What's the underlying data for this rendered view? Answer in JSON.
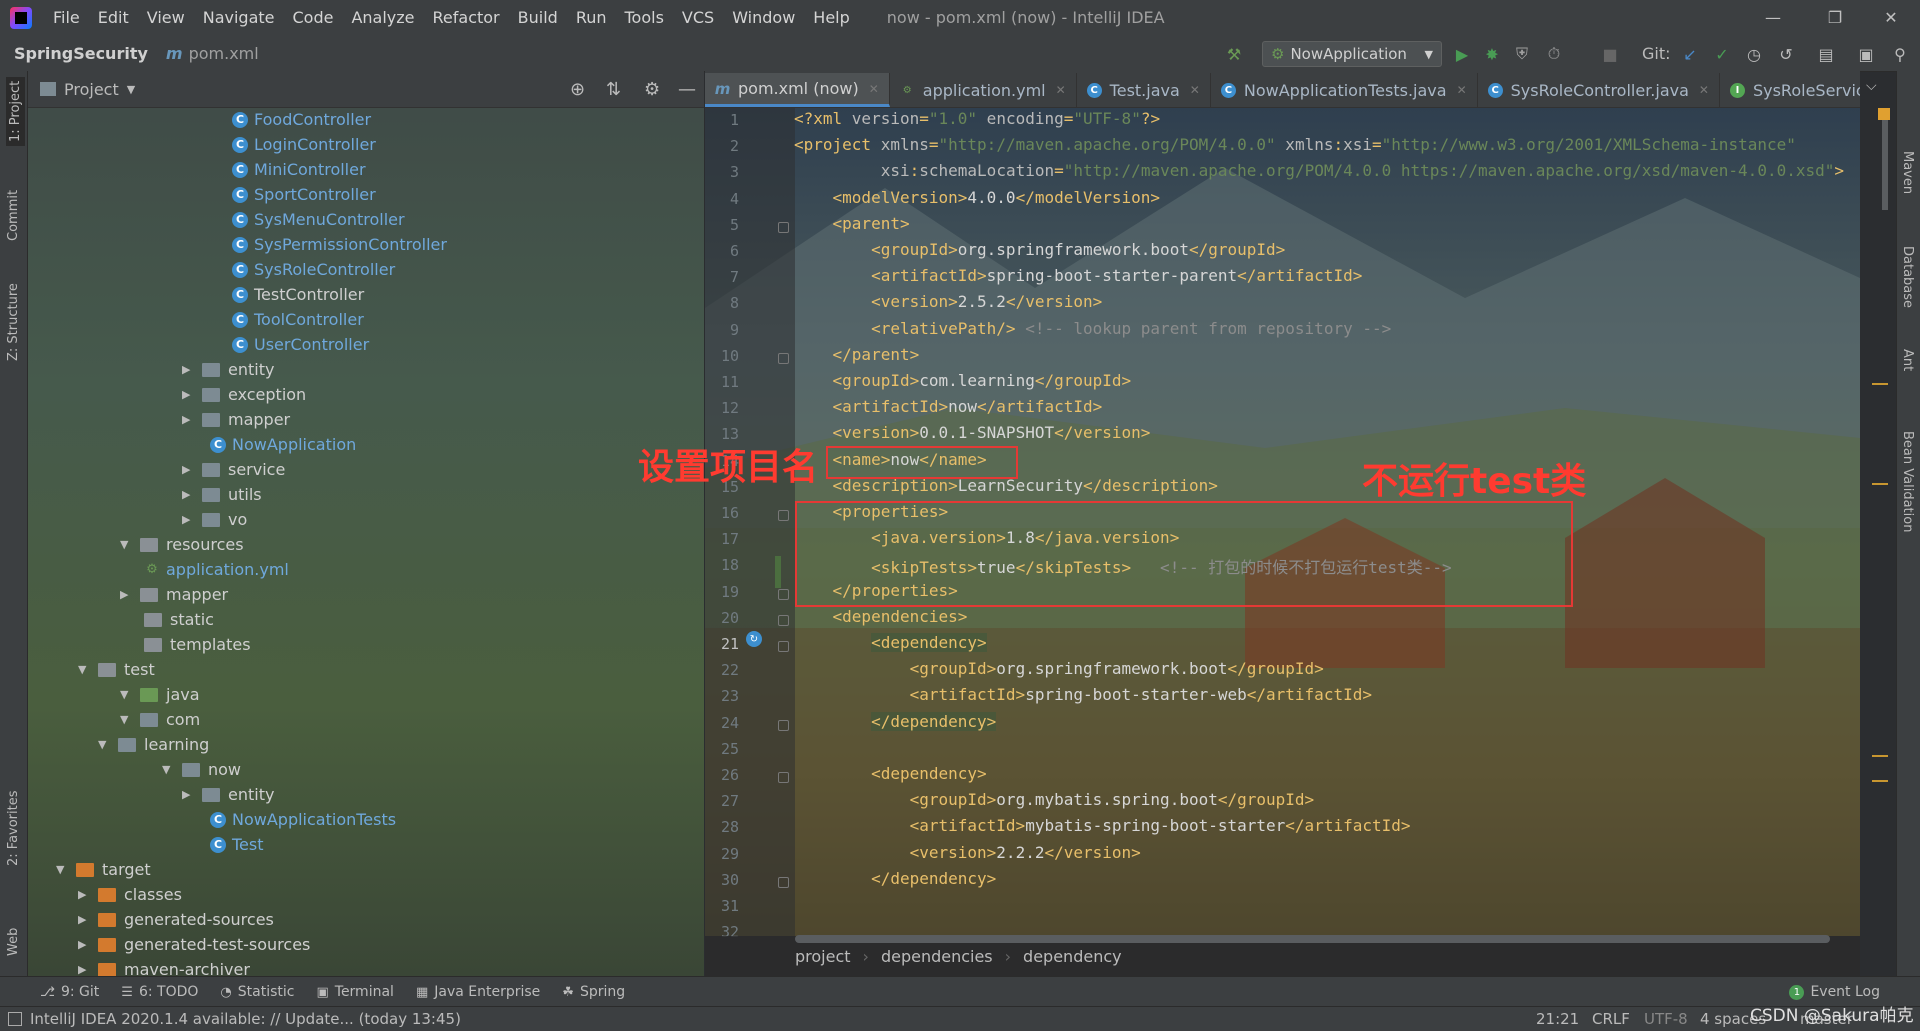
{
  "window": {
    "title": "now - pom.xml (now) - IntelliJ IDEA",
    "menu": [
      "File",
      "Edit",
      "View",
      "Navigate",
      "Code",
      "Analyze",
      "Refactor",
      "Build",
      "Run",
      "Tools",
      "VCS",
      "Window",
      "Help"
    ]
  },
  "navbar": {
    "project": "SpringSecurity",
    "file": "pom.xml",
    "file_icon": "m",
    "run_config": "NowApplication",
    "git_label": "Git:"
  },
  "project_panel": {
    "title": "Project",
    "tree": [
      {
        "label": "FoodController",
        "type": "class",
        "indent": 0
      },
      {
        "label": "LoginController",
        "type": "class",
        "indent": 0
      },
      {
        "label": "MiniController",
        "type": "class",
        "indent": 0
      },
      {
        "label": "SportController",
        "type": "class",
        "indent": 0
      },
      {
        "label": "SysMenuController",
        "type": "class",
        "indent": 0
      },
      {
        "label": "SysPermissionController",
        "type": "class",
        "indent": 0
      },
      {
        "label": "SysRoleController",
        "type": "class",
        "indent": 0
      },
      {
        "label": "TestController",
        "type": "class",
        "indent": 0
      },
      {
        "label": "ToolController",
        "type": "class",
        "indent": 0
      },
      {
        "label": "UserController",
        "type": "class",
        "indent": 0
      },
      {
        "label": "entity",
        "type": "pkg",
        "indent": 1
      },
      {
        "label": "exception",
        "type": "pkg",
        "indent": 1
      },
      {
        "label": "mapper",
        "type": "pkg",
        "indent": 1
      },
      {
        "label": "NowApplication",
        "type": "app",
        "indent": 2
      },
      {
        "label": "service",
        "type": "pkg",
        "indent": 1
      },
      {
        "label": "utils",
        "type": "pkg",
        "indent": 1
      },
      {
        "label": "vo",
        "type": "pkg",
        "indent": 1
      },
      {
        "label": "resources",
        "type": "folder-open",
        "indent": 3
      },
      {
        "label": "application.yml",
        "type": "yml",
        "indent": 4
      },
      {
        "label": "mapper",
        "type": "folder",
        "indent": 5
      },
      {
        "label": "static",
        "type": "folder-leaf",
        "indent": 4
      },
      {
        "label": "templates",
        "type": "folder-leaf",
        "indent": 4
      },
      {
        "label": "test",
        "type": "folder-open",
        "indent": 6
      },
      {
        "label": "java",
        "type": "folder-open-green",
        "indent": 3
      },
      {
        "label": "com",
        "type": "pkg-open",
        "indent": 5
      },
      {
        "label": "learning",
        "type": "pkg-open",
        "indent": 7
      },
      {
        "label": "now",
        "type": "pkg-open",
        "indent": 8
      },
      {
        "label": "entity",
        "type": "pkg",
        "indent": 1
      },
      {
        "label": "NowApplicationTests",
        "type": "testclass",
        "indent": 2
      },
      {
        "label": "Test",
        "type": "testclass",
        "indent": 2
      },
      {
        "label": "target",
        "type": "folder-open-orange",
        "indent": 9
      },
      {
        "label": "classes",
        "type": "folder-orange",
        "indent": 10
      },
      {
        "label": "generated-sources",
        "type": "folder-orange",
        "indent": 10
      },
      {
        "label": "generated-test-sources",
        "type": "folder-orange",
        "indent": 10
      },
      {
        "label": "maven-archiver",
        "type": "folder-orange",
        "indent": 10
      }
    ]
  },
  "tabs": [
    {
      "label": "pom.xml (now)",
      "icon": "m",
      "active": true
    },
    {
      "label": "application.yml",
      "icon": "y",
      "active": false
    },
    {
      "label": "Test.java",
      "icon": "c",
      "active": false
    },
    {
      "label": "NowApplicationTests.java",
      "icon": "c",
      "active": false
    },
    {
      "label": "SysRoleController.java",
      "icon": "c",
      "active": false
    },
    {
      "label": "SysRoleService.java",
      "icon": "i",
      "active": false
    }
  ],
  "editor": {
    "lines": [
      "1",
      "2",
      "3",
      "4",
      "5",
      "6",
      "7",
      "8",
      "9",
      "10",
      "11",
      "12",
      "13",
      "14",
      "15",
      "16",
      "17",
      "18",
      "19",
      "20",
      "21",
      "22",
      "23",
      "24",
      "25",
      "26",
      "27",
      "28",
      "29",
      "30",
      "31",
      "32"
    ],
    "code": [
      [
        [
          "tag",
          "<?xml "
        ],
        [
          "attr",
          "version"
        ],
        [
          "tag",
          "="
        ],
        [
          "val",
          "\"1.0\""
        ],
        [
          "attr",
          " encoding"
        ],
        [
          "tag",
          "="
        ],
        [
          "val",
          "\"UTF-8\""
        ],
        [
          "tag",
          "?>"
        ]
      ],
      [
        [
          "tag",
          "<project "
        ],
        [
          "attr",
          "xmlns"
        ],
        [
          "tag",
          "="
        ],
        [
          "val",
          "\"http://maven.apache.org/POM/4.0.0\""
        ],
        [
          "attr",
          " xmlns"
        ],
        [
          "tag",
          ":"
        ],
        [
          "attr",
          "xsi"
        ],
        [
          "tag",
          "="
        ],
        [
          "val",
          "\"http://www.w3.org/2001/XMLSchema-instance\""
        ]
      ],
      [
        [
          "txt",
          "         "
        ],
        [
          "attr",
          "xsi"
        ],
        [
          "tag",
          ":"
        ],
        [
          "attr",
          "schemaLocation"
        ],
        [
          "tag",
          "="
        ],
        [
          "val",
          "\"http://maven.apache.org/POM/4.0.0 https://maven.apache.org/xsd/maven-4.0.0.xsd\""
        ],
        [
          "tag",
          ">"
        ]
      ],
      [
        [
          "txt",
          "    "
        ],
        [
          "tag",
          "<modelVersion>"
        ],
        [
          "txt",
          "4.0.0"
        ],
        [
          "tag",
          "</modelVersion>"
        ]
      ],
      [
        [
          "txt",
          "    "
        ],
        [
          "tag",
          "<parent>"
        ]
      ],
      [
        [
          "txt",
          "        "
        ],
        [
          "tag",
          "<groupId>"
        ],
        [
          "txt",
          "org.springframework.boot"
        ],
        [
          "tag",
          "</groupId>"
        ]
      ],
      [
        [
          "txt",
          "        "
        ],
        [
          "tag",
          "<artifactId>"
        ],
        [
          "txt",
          "spring-boot-starter-parent"
        ],
        [
          "tag",
          "</artifactId>"
        ]
      ],
      [
        [
          "txt",
          "        "
        ],
        [
          "tag",
          "<version>"
        ],
        [
          "txt",
          "2.5.2"
        ],
        [
          "tag",
          "</version>"
        ]
      ],
      [
        [
          "txt",
          "        "
        ],
        [
          "tag",
          "<relativePath/>"
        ],
        [
          "cmt",
          " <!-- lookup parent from repository -->"
        ]
      ],
      [
        [
          "txt",
          "    "
        ],
        [
          "tag",
          "</parent>"
        ]
      ],
      [
        [
          "txt",
          "    "
        ],
        [
          "tag",
          "<groupId>"
        ],
        [
          "txt",
          "com.learning"
        ],
        [
          "tag",
          "</groupId>"
        ]
      ],
      [
        [
          "txt",
          "    "
        ],
        [
          "tag",
          "<artifactId>"
        ],
        [
          "txt",
          "now"
        ],
        [
          "tag",
          "</artifactId>"
        ]
      ],
      [
        [
          "txt",
          "    "
        ],
        [
          "tag",
          "<version>"
        ],
        [
          "txt",
          "0.0.1-SNAPSHOT"
        ],
        [
          "tag",
          "</version>"
        ]
      ],
      [
        [
          "txt",
          "    "
        ],
        [
          "tag",
          "<name>"
        ],
        [
          "txt",
          "now"
        ],
        [
          "tag",
          "</name>"
        ]
      ],
      [
        [
          "txt",
          "    "
        ],
        [
          "tag",
          "<description>"
        ],
        [
          "txt",
          "LearnSecurity"
        ],
        [
          "tag",
          "</description>"
        ]
      ],
      [
        [
          "txt",
          "    "
        ],
        [
          "tag",
          "<properties>"
        ]
      ],
      [
        [
          "txt",
          "        "
        ],
        [
          "tag",
          "<java.version>"
        ],
        [
          "txt",
          "1.8"
        ],
        [
          "tag",
          "</java.version>"
        ]
      ],
      [
        [
          "txt",
          "        "
        ],
        [
          "tag",
          "<skipTests>"
        ],
        [
          "txt",
          "true"
        ],
        [
          "tag",
          "</skipTests>"
        ],
        [
          "cmt",
          "   <!-- 打包的时候不打包运行test类-->"
        ]
      ],
      [
        [
          "txt",
          "    "
        ],
        [
          "tag",
          "</properties>"
        ]
      ],
      [
        [
          "txt",
          "    "
        ],
        [
          "tag",
          "<dependencies>"
        ]
      ],
      [
        [
          "txt",
          "        "
        ],
        [
          "hl",
          "<dependency>"
        ]
      ],
      [
        [
          "txt",
          "            "
        ],
        [
          "tag",
          "<groupId>"
        ],
        [
          "txt",
          "org.springframework.boot"
        ],
        [
          "tag",
          "</groupId>"
        ]
      ],
      [
        [
          "txt",
          "            "
        ],
        [
          "tag",
          "<artifactId>"
        ],
        [
          "txt",
          "spring-boot-starter-web"
        ],
        [
          "tag",
          "</artifactId>"
        ]
      ],
      [
        [
          "txt",
          "        "
        ],
        [
          "hl",
          "</dependency>"
        ]
      ],
      [
        [
          "txt",
          ""
        ]
      ],
      [
        [
          "txt",
          "        "
        ],
        [
          "tag",
          "<dependency>"
        ]
      ],
      [
        [
          "txt",
          "            "
        ],
        [
          "tag",
          "<groupId>"
        ],
        [
          "txt",
          "org.mybatis.spring.boot"
        ],
        [
          "tag",
          "</groupId>"
        ]
      ],
      [
        [
          "txt",
          "            "
        ],
        [
          "tag",
          "<artifactId>"
        ],
        [
          "txt",
          "mybatis-spring-boot-starter"
        ],
        [
          "tag",
          "</artifactId>"
        ]
      ],
      [
        [
          "txt",
          "            "
        ],
        [
          "tag",
          "<version>"
        ],
        [
          "txt",
          "2.2.2"
        ],
        [
          "tag",
          "</version>"
        ]
      ],
      [
        [
          "txt",
          "        "
        ],
        [
          "tag",
          "</dependency>"
        ]
      ],
      [
        [
          "txt",
          ""
        ]
      ],
      [
        [
          "txt",
          ""
        ]
      ]
    ]
  },
  "annotations": {
    "set_project_name": "设置项目名",
    "skip_test": "不运行test类"
  },
  "breadcrumb": [
    "project",
    "dependencies",
    "dependency"
  ],
  "right_tools": [
    "Maven",
    "Database",
    "Ant",
    "Bean Validation"
  ],
  "left_tools": [
    "1: Project",
    "Commit",
    "Z: Structure",
    "2: Favorites",
    "Web"
  ],
  "bottom_tools": [
    {
      "label": "9: Git",
      "icon": "git-icon"
    },
    {
      "label": "6: TODO",
      "icon": "list-icon"
    },
    {
      "label": "Statistic",
      "icon": "stat-icon"
    },
    {
      "label": "Terminal",
      "icon": "terminal-icon"
    },
    {
      "label": "Java Enterprise",
      "icon": "je-icon"
    },
    {
      "label": "Spring",
      "icon": "spring-icon"
    }
  ],
  "event_log": {
    "count": "1",
    "label": "Event Log"
  },
  "status": {
    "message": "IntelliJ IDEA 2020.1.4 available: // Update... (today 13:45)",
    "position": "21:21",
    "line_sep": "CRLF",
    "encoding": "UTF-8",
    "indent": "4 spaces",
    "branch": "master",
    "watermark": "CSDN @Sakura帕克"
  },
  "colors": {
    "accent": "#4a88c7",
    "annotation_red": "#e53935"
  }
}
